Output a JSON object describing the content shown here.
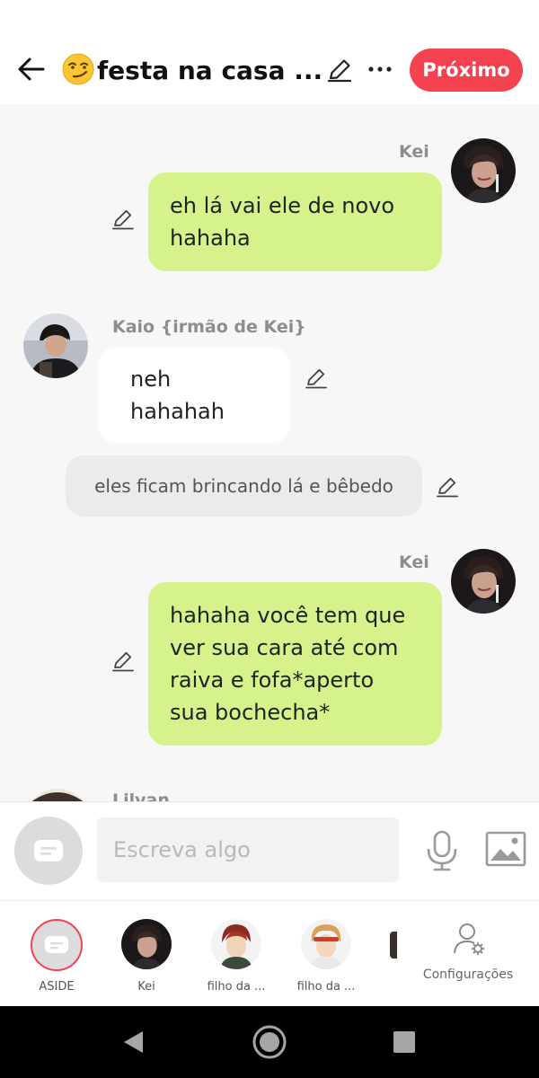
{
  "header": {
    "title": "festa na casa ...",
    "next_label": "Próximo"
  },
  "messages": [
    {
      "side": "right",
      "author": "Kei",
      "text_lines": [
        "eh lá vai ele de novo",
        "hahaha"
      ]
    },
    {
      "side": "left",
      "author": "Kaio {irmão de Kei}",
      "text": "neh hahahah"
    },
    {
      "side": "center",
      "type": "narration",
      "text": "eles ficam brincando lá e bêbedo"
    },
    {
      "side": "right",
      "author": "Kei",
      "text_lines": [
        "hahaha você tem que",
        "ver sua cara até com",
        "raiva e fofa*aperto",
        "sua bochecha*"
      ]
    },
    {
      "side": "left",
      "author": "Lilyan",
      "partial": true
    }
  ],
  "composer": {
    "placeholder": "Escreva algo"
  },
  "characters": [
    {
      "label": "ASIDE",
      "selected": true
    },
    {
      "label": "Kei"
    },
    {
      "label": "filho da ..."
    },
    {
      "label": "filho da ..."
    }
  ],
  "settings_label": "Configurações",
  "colors": {
    "accent": "#f44250",
    "bubble_green": "#d6f28a",
    "bubble_white": "#ffffff",
    "narration_bg": "#ebebeb"
  }
}
